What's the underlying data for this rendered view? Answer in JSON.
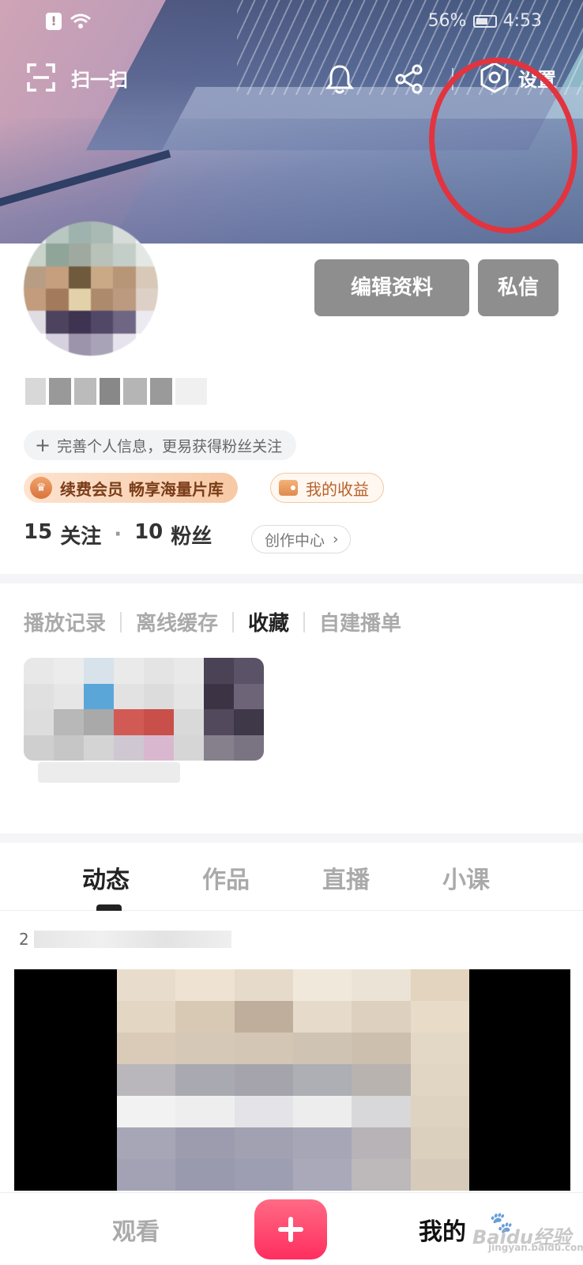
{
  "status_bar": {
    "alert_glyph": "!",
    "battery_text": "56%",
    "time": "4:53"
  },
  "toolbar": {
    "scan_label": "扫一扫",
    "settings_label": "设置"
  },
  "profile": {
    "edit_button": "编辑资料",
    "message_button": "私信",
    "complete_info": "完善个人信息，更易获得粉丝关注",
    "vip_chip": "续费会员 畅享海量片库",
    "income_chip": "我的收益",
    "following_count": "15",
    "following_label": "关注",
    "separator_dot": "·",
    "followers_count": "10",
    "followers_label": "粉丝",
    "creator_center": "创作中心",
    "chevron": "›"
  },
  "history_tabs": [
    {
      "label": "播放记录",
      "active": false
    },
    {
      "label": "离线缓存",
      "active": false
    },
    {
      "label": "收藏",
      "active": true
    },
    {
      "label": "自建播单",
      "active": false
    }
  ],
  "main_tabs": [
    {
      "label": "动态",
      "active": true
    },
    {
      "label": "作品",
      "active": false
    },
    {
      "label": "直播",
      "active": false
    },
    {
      "label": "小课",
      "active": false
    }
  ],
  "post": {
    "date_lead": "2"
  },
  "bottom_nav": {
    "watch": "观看",
    "mine": "我的"
  },
  "watermark": {
    "text": "Baidu经验",
    "url": "jingyan.baidu.com"
  },
  "colors": {
    "highlight_ring": "#e1343f",
    "add_button": "#ff2e5e",
    "button_gray": "#8e8e8e"
  }
}
